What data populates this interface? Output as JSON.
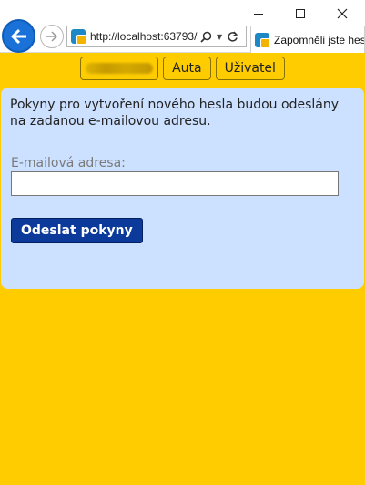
{
  "browser": {
    "url": "http://localhost:63793/",
    "tab_title": "Zapomněli jste heslo"
  },
  "nav": {
    "items": [
      "Auta",
      "Uživatel"
    ]
  },
  "form": {
    "instructions": "Pokyny pro vytvoření nového hesla budou odeslány na zadanou e-mailovou adresu.",
    "email_label": "E-mailová adresa:",
    "email_value": "",
    "submit_label": "Odeslat pokyny"
  },
  "colors": {
    "page_background": "#ffcc00",
    "panel_background": "#cce0ff",
    "submit_button": "#0b3a9a",
    "back_button": "#1a72d9"
  }
}
